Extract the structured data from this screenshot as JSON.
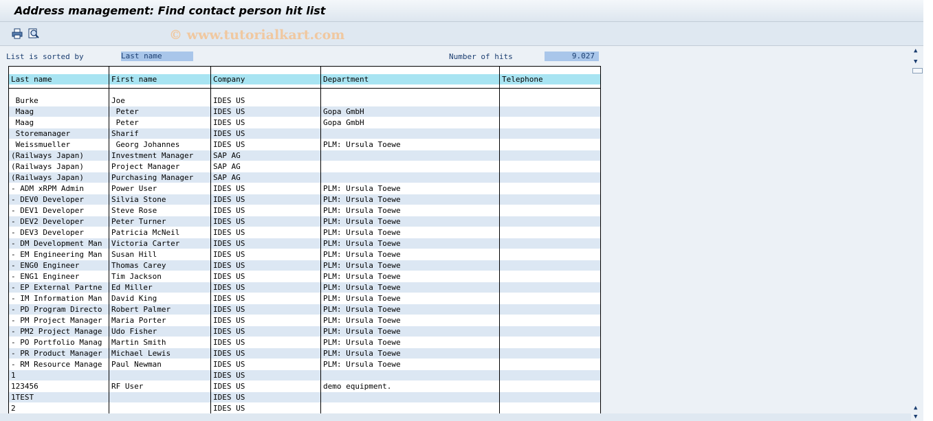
{
  "window": {
    "title": "Address management: Find contact person hit list"
  },
  "watermark": "© www.tutorialkart.com",
  "toolbar": {
    "print_icon": "printer-icon",
    "find_icon": "find-icon"
  },
  "sort": {
    "label": "List is sorted by",
    "value": "Last name"
  },
  "hits": {
    "label": "Number of hits",
    "value": "9.027"
  },
  "table": {
    "columns": [
      "Last name",
      "First name",
      "Company",
      "Department",
      "Telephone"
    ],
    "rows": [
      [
        " Burke",
        "Joe",
        "IDES US",
        "",
        ""
      ],
      [
        " Maag",
        " Peter",
        "IDES US",
        "Gopa GmbH",
        ""
      ],
      [
        " Maag",
        " Peter",
        "IDES US",
        "Gopa GmbH",
        ""
      ],
      [
        " Storemanager",
        "Sharif",
        "IDES US",
        "",
        ""
      ],
      [
        " Weissmueller",
        " Georg Johannes",
        "IDES US",
        "PLM: Ursula Toewe",
        ""
      ],
      [
        "(Railways Japan)",
        "Investment Manager",
        "SAP AG",
        "",
        ""
      ],
      [
        "(Railways Japan)",
        "Project Manager",
        "SAP AG",
        "",
        ""
      ],
      [
        "(Railways Japan)",
        "Purchasing Manager",
        "SAP AG",
        "",
        ""
      ],
      [
        "- ADM xRPM Admin",
        "Power User",
        "IDES US",
        "PLM: Ursula Toewe",
        ""
      ],
      [
        "- DEV0 Developer",
        "Silvia Stone",
        "IDES US",
        "PLM: Ursula Toewe",
        ""
      ],
      [
        "- DEV1 Developer",
        "Steve Rose",
        "IDES US",
        "PLM: Ursula Toewe",
        ""
      ],
      [
        "- DEV2 Developer",
        "Peter Turner",
        "IDES US",
        "PLM: Ursula Toewe",
        ""
      ],
      [
        "- DEV3 Developer",
        "Patricia McNeil",
        "IDES US",
        "PLM: Ursula Toewe",
        ""
      ],
      [
        "- DM Development Man",
        "Victoria Carter",
        "IDES US",
        "PLM: Ursula Toewe",
        ""
      ],
      [
        "- EM Engineering Man",
        "Susan Hill",
        "IDES US",
        "PLM: Ursula Toewe",
        ""
      ],
      [
        "- ENG0 Engineer",
        "Thomas Carey",
        "IDES US",
        "PLM: Ursula Toewe",
        ""
      ],
      [
        "- ENG1 Engineer",
        "Tim Jackson",
        "IDES US",
        "PLM: Ursula Toewe",
        ""
      ],
      [
        "- EP External Partne",
        "Ed Miller",
        "IDES US",
        "PLM: Ursula Toewe",
        ""
      ],
      [
        "- IM Information Man",
        "David King",
        "IDES US",
        "PLM: Ursula Toewe",
        ""
      ],
      [
        "- PD Program Directo",
        "Robert Palmer",
        "IDES US",
        "PLM: Ursula Toewe",
        ""
      ],
      [
        "- PM Project Manager",
        "Maria Porter",
        "IDES US",
        "PLM: Ursula Toewe",
        ""
      ],
      [
        "- PM2 Project Manage",
        "Udo Fisher",
        "IDES US",
        "PLM: Ursula Toewe",
        ""
      ],
      [
        "- PO Portfolio Manag",
        "Martin Smith",
        "IDES US",
        "PLM: Ursula Toewe",
        ""
      ],
      [
        "- PR Product Manager",
        "Michael Lewis",
        "IDES US",
        "PLM: Ursula Toewe",
        ""
      ],
      [
        "- RM Resource Manage",
        "Paul Newman",
        "IDES US",
        "PLM: Ursula Toewe",
        ""
      ],
      [
        "1",
        "",
        "IDES US",
        "",
        ""
      ],
      [
        "123456",
        "RF User",
        "IDES US",
        "demo equipment.",
        ""
      ],
      [
        "1TEST",
        "",
        "IDES US",
        "",
        ""
      ],
      [
        "2",
        "",
        "IDES US",
        "",
        ""
      ]
    ]
  }
}
